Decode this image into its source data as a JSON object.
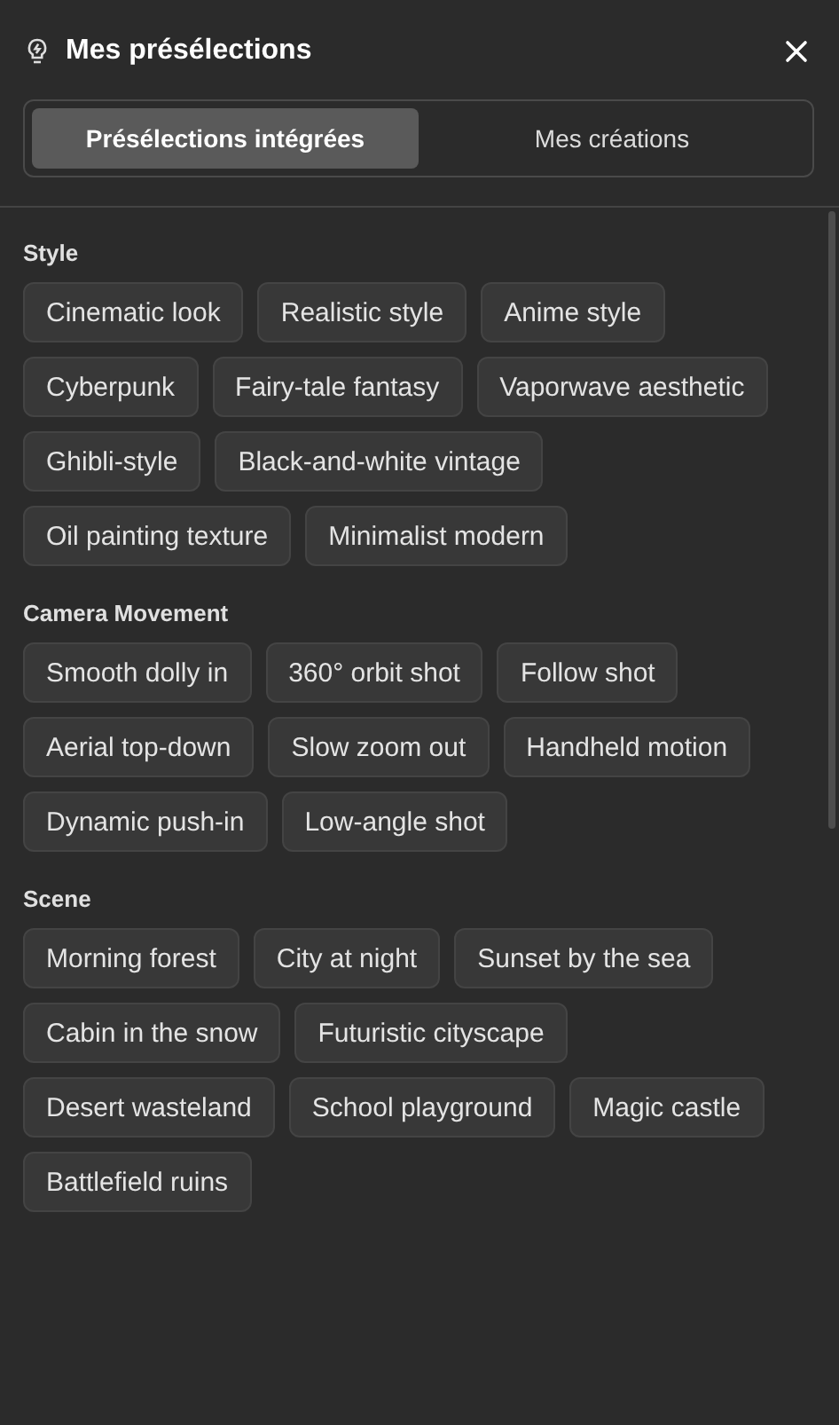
{
  "header": {
    "title": "Mes présélections"
  },
  "tabs": [
    {
      "label": "Présélections intégrées",
      "selected": true
    },
    {
      "label": "Mes créations",
      "selected": false
    }
  ],
  "sections": [
    {
      "title": "Style",
      "chips": [
        "Cinematic look",
        "Realistic style",
        "Anime style",
        "Cyberpunk",
        "Fairy-tale fantasy",
        "Vaporwave aesthetic",
        "Ghibli-style",
        "Black-and-white vintage",
        "Oil painting texture",
        "Minimalist modern"
      ]
    },
    {
      "title": "Camera Movement",
      "chips": [
        "Smooth dolly in",
        "360° orbit shot",
        "Follow shot",
        "Aerial top-down",
        "Slow zoom out",
        "Handheld motion",
        "Dynamic push-in",
        "Low-angle shot"
      ]
    },
    {
      "title": "Scene",
      "chips": [
        "Morning forest",
        "City at night",
        "Sunset by the sea",
        "Cabin in the snow",
        "Futuristic cityscape",
        "Desert wasteland",
        "School playground",
        "Magic castle",
        "Battlefield ruins"
      ]
    }
  ]
}
